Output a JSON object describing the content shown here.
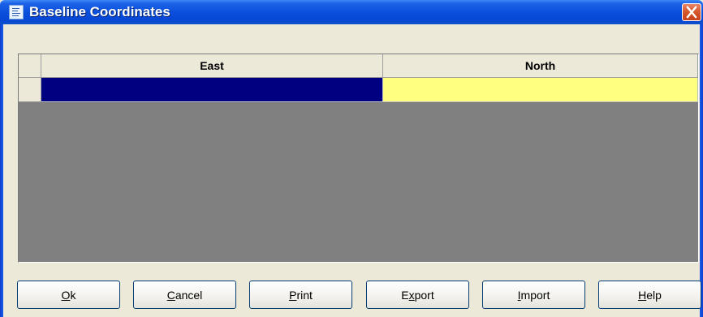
{
  "window": {
    "title": "Baseline Coordinates",
    "title_icon": "app-grid-icon",
    "close_icon": "close-icon",
    "close_color": "#d75a2e"
  },
  "grid": {
    "columns": [
      "East",
      "North"
    ],
    "rows": [
      {
        "east": "",
        "north": ""
      }
    ],
    "selected_cell_color": "#000080",
    "edit_cell_color": "#ffff80",
    "empty_area_color": "#808080"
  },
  "buttons": [
    {
      "mnemonic": "O",
      "rest": "k"
    },
    {
      "mnemonic": "C",
      "rest": "ancel"
    },
    {
      "mnemonic": "P",
      "rest": "rint"
    },
    {
      "pre": "E",
      "mnemonic": "x",
      "rest": "port"
    },
    {
      "mnemonic": "I",
      "rest": "mport"
    },
    {
      "mnemonic": "H",
      "rest": "elp"
    }
  ]
}
